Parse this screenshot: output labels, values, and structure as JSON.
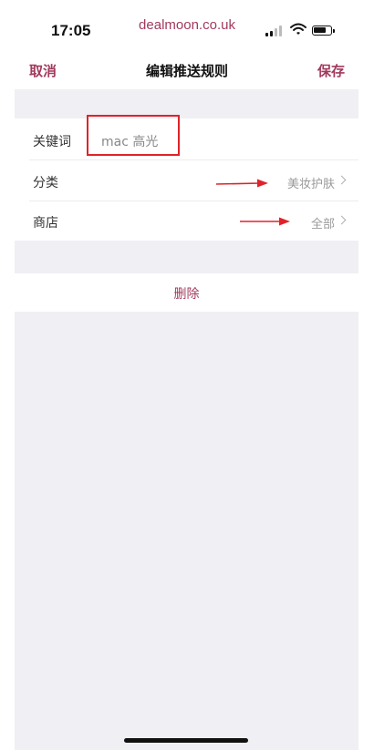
{
  "status_bar": {
    "time": "17:05",
    "domain": "dealmoon.co.uk",
    "signal_icon": "cellular-signal-icon",
    "wifi_icon": "wifi-icon",
    "battery_icon": "battery-icon"
  },
  "nav": {
    "cancel_label": "取消",
    "title": "编辑推送规则",
    "save_label": "保存"
  },
  "form": {
    "keyword": {
      "label": "关键词",
      "value": "mac 高光"
    },
    "category": {
      "label": "分类",
      "value": "美妆护肤"
    },
    "store": {
      "label": "商店",
      "value": "全部"
    }
  },
  "delete_label": "删除",
  "colors": {
    "accent": "#a23a5e",
    "annotation_red": "#e0232a",
    "background": "#efeff4"
  }
}
